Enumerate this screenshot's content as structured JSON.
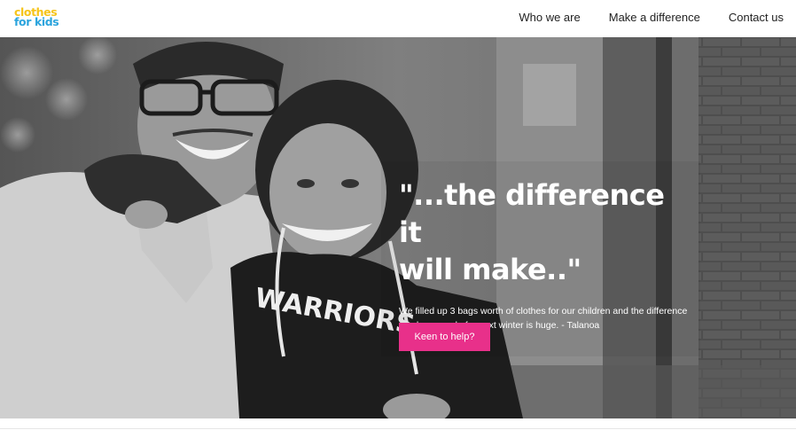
{
  "brand": {
    "line1": "clothes",
    "line2": "for kids",
    "color1": "#f6c41a",
    "color2": "#2ba4dd"
  },
  "nav": [
    {
      "label": "Who we are"
    },
    {
      "label": "Make a difference"
    },
    {
      "label": "Contact us"
    }
  ],
  "hero": {
    "title_line1": "\"...the difference it",
    "title_line2": "will make..\"",
    "quote": "We filled up 3 bags worth of clothes for our children and the difference you have made for next winter is huge. - Talanoa",
    "button_label": "Keen to help?",
    "button_color": "#e8308a",
    "photo_jersey_text": "WARRIORS"
  }
}
